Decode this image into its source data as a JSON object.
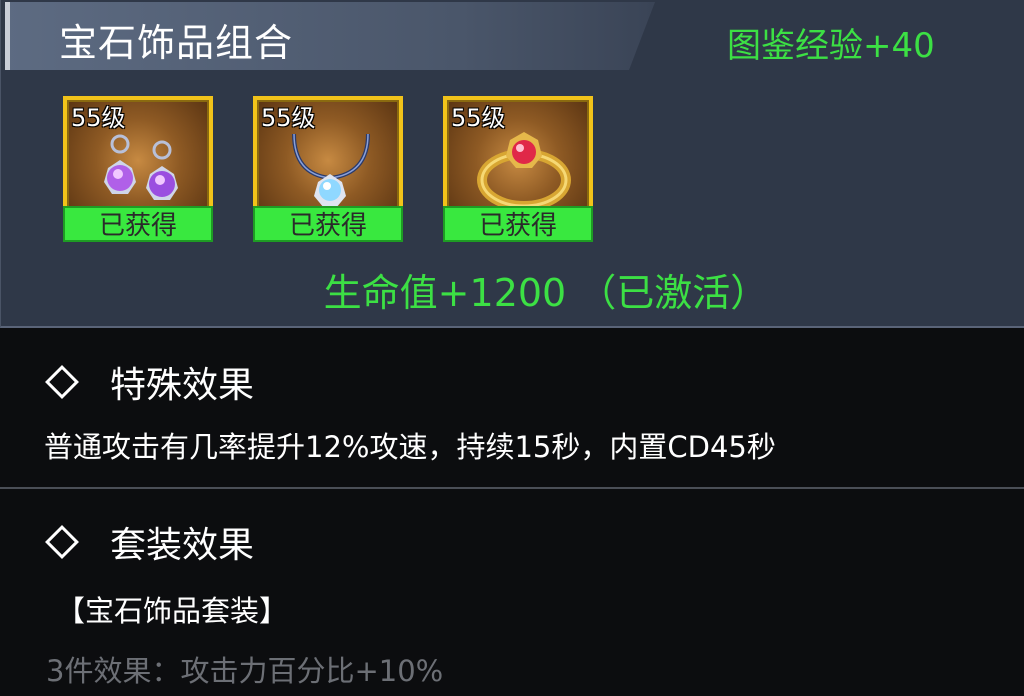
{
  "panel": {
    "title": "宝石饰品组合",
    "codex_exp": "图鉴经验+40"
  },
  "items": [
    {
      "level": "55级",
      "status": "已获得",
      "icon": "earrings-icon"
    },
    {
      "level": "55级",
      "status": "已获得",
      "icon": "necklace-icon"
    },
    {
      "level": "55级",
      "status": "已获得",
      "icon": "ring-icon"
    }
  ],
  "set_bonus": "生命值+1200 （已激活）",
  "special": {
    "title": "特殊效果",
    "description": "普通攻击有几率提升12%攻速，持续15秒，内置CD45秒"
  },
  "suit": {
    "title": "套装效果",
    "set_name": "【宝石饰品套装】",
    "piece_bonus": "3件效果：攻击力百分比+10%"
  },
  "colors": {
    "accent_green": "#3ce044",
    "frame_gold": "#f2c31a",
    "panel_bg": "#2f3848",
    "inactive_text": "#6c6f75"
  }
}
